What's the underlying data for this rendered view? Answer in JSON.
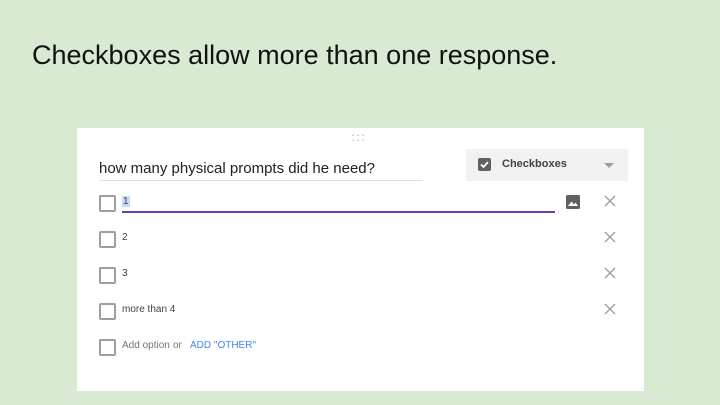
{
  "slide": {
    "title": "Checkboxes allow more than one response."
  },
  "form": {
    "drag_handle": ":::",
    "question": "how many physical prompts did he need?",
    "question_type": "Checkboxes",
    "options": [
      {
        "label": "1"
      },
      {
        "label": "2"
      },
      {
        "label": "3"
      },
      {
        "label": "more than 4"
      }
    ],
    "add_option_label": "Add option",
    "or_label": "or",
    "add_other_label": "ADD \"OTHER\""
  },
  "colors": {
    "slide_background": "#d9ead3",
    "accent_underline": "#673ab7",
    "link_blue": "#4285f4"
  }
}
